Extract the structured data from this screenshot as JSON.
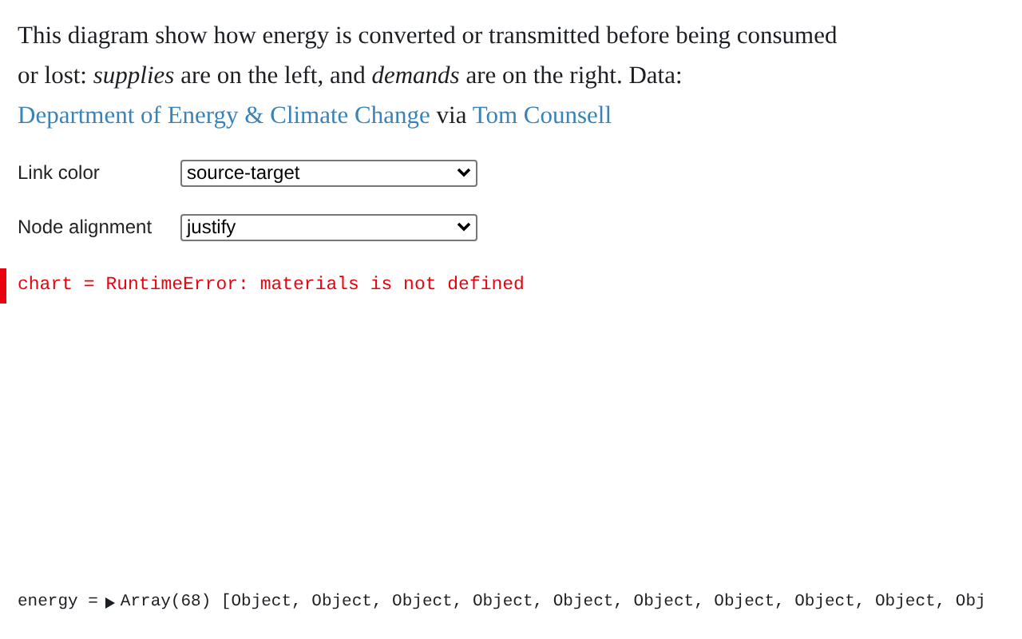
{
  "description": [
    {
      "kind": "text",
      "text": "This diagram show how energy is converted or transmitted before being consumed or lost: *supplies* are on the left, and *demands* are on the right. Data: "
    },
    {
      "kind": "link",
      "text": "Department of Energy & Climate Change"
    },
    {
      "kind": "text",
      "text": " via "
    },
    {
      "kind": "link",
      "text": "Tom Counsell"
    }
  ],
  "controls": [
    {
      "label": "Link color",
      "value": "source-target"
    },
    {
      "label": "Node alignment",
      "value": "justify"
    }
  ],
  "error": {
    "text": "chart = RuntimeError: materials is not defined"
  },
  "energy": {
    "name": "energy =",
    "value": "Array(68) [Object, Object, Object, Object, Object, Object, Object, Object, Object, Obj",
    "expanded": false
  }
}
